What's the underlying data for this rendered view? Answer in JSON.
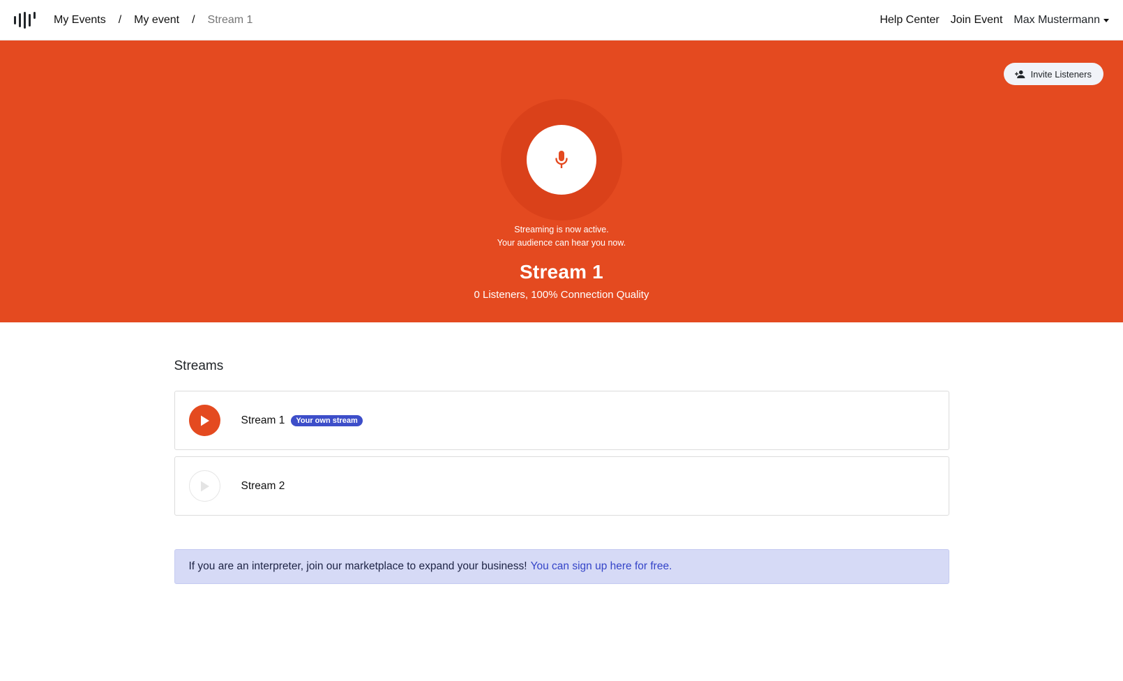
{
  "nav": {
    "breadcrumb": [
      "My Events",
      "My event",
      "Stream 1"
    ],
    "separator": "/",
    "help_center": "Help Center",
    "join_event": "Join Event",
    "user_name": "Max Mustermann"
  },
  "hero": {
    "invite_label": "Invite Listeners",
    "status_line1": "Streaming is now active.",
    "status_line2": "Your audience can hear you now.",
    "stream_title": "Stream 1",
    "stream_stats": "0 Listeners, 100% Connection Quality",
    "accent_color": "#e44a20"
  },
  "streams": {
    "title": "Streams",
    "items": [
      {
        "name": "Stream 1",
        "badge": "Your own stream",
        "active": true
      },
      {
        "name": "Stream 2",
        "badge": "",
        "active": false
      }
    ]
  },
  "banner": {
    "text": "If you are an interpreter, join our marketplace to expand your business!",
    "link": "You can sign up here for free."
  },
  "icons": {
    "logo": "waveform-logo-icon",
    "invite": "person-add-icon",
    "mic": "microphone-icon",
    "play": "play-icon",
    "user_caret": "caret-down-icon"
  }
}
